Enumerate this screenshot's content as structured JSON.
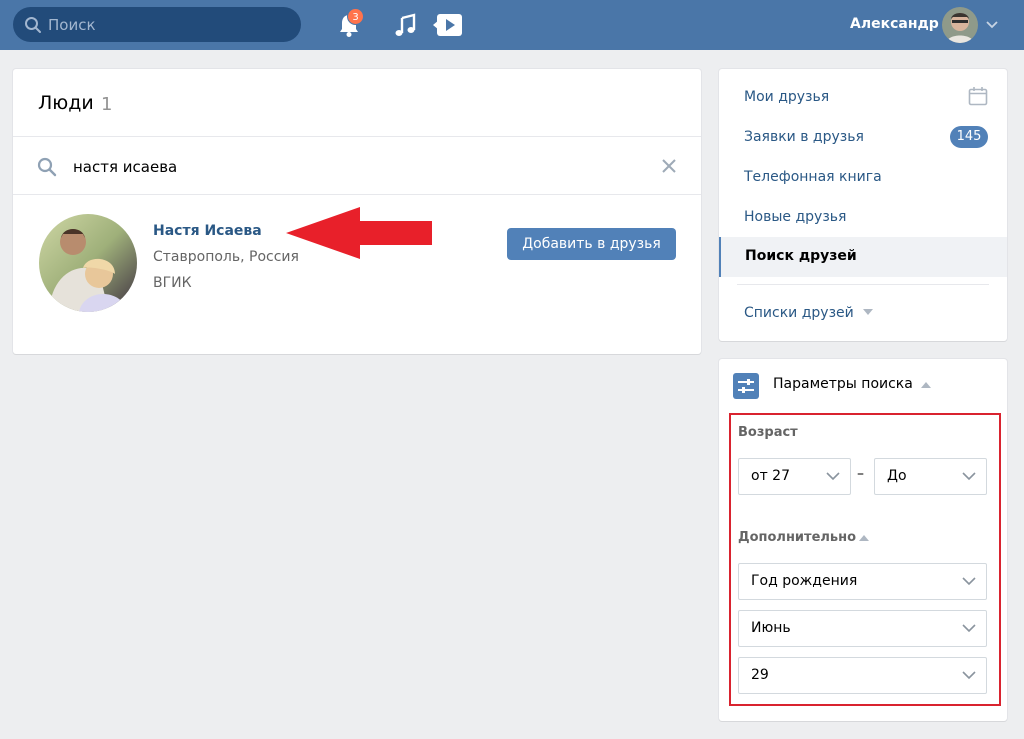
{
  "header": {
    "search_placeholder": "Поиск",
    "notifications_count": "3",
    "user_name": "Александр"
  },
  "people": {
    "title": "Люди",
    "count": "1",
    "query": "настя исаева",
    "results": [
      {
        "name": "Настя Исаева",
        "city": "Ставрополь, Россия",
        "university": "ВГИК",
        "action_label": "Добавить в друзья"
      }
    ]
  },
  "friends_menu": {
    "items": [
      {
        "label": "Мои друзья"
      },
      {
        "label": "Заявки в друзья",
        "badge": "145"
      },
      {
        "label": "Телефонная книга"
      },
      {
        "label": "Новые друзья"
      },
      {
        "label": "Поиск друзей",
        "active": true
      }
    ],
    "lists_label": "Списки друзей"
  },
  "search_params": {
    "title": "Параметры поиска",
    "age_label": "Возраст",
    "age_from": "от 27",
    "age_to": "До",
    "age_separator": "–",
    "extra_label": "Дополнительно",
    "birth_year": "Год рождения",
    "birth_month": "Июнь",
    "birth_day": "29"
  },
  "colors": {
    "header_bg": "#4a76a8",
    "accent": "#5181b8",
    "link": "#2a5885",
    "highlight_box": "#d9232f",
    "arrow": "#e8202a"
  }
}
